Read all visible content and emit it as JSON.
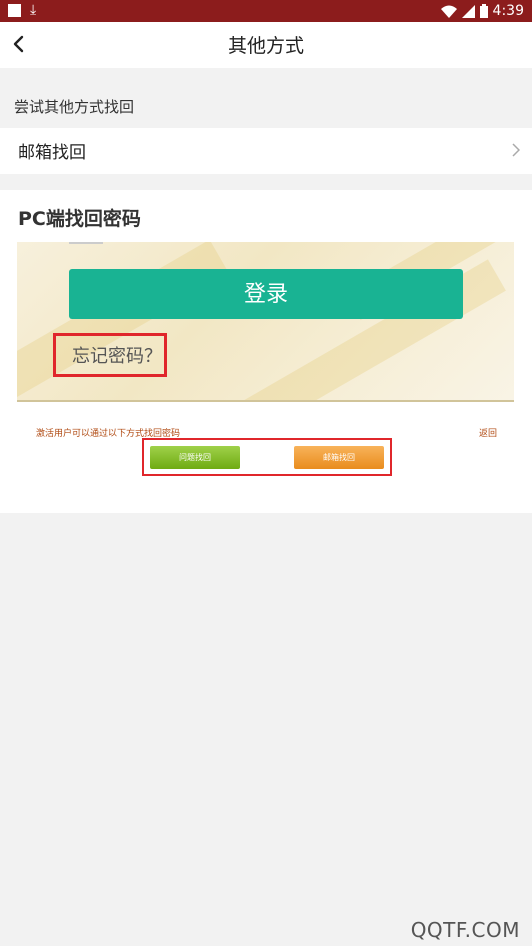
{
  "status_bar": {
    "time": "4:39"
  },
  "header": {
    "title": "其他方式"
  },
  "section": {
    "label": "尝试其他方式找回"
  },
  "email_option": {
    "label": "邮箱找回"
  },
  "pc_section": {
    "heading": "PC端找回密码",
    "screenshot": {
      "login_label": "登录",
      "forgot_label": "忘记密码？",
      "hint": "激活用户可以通过以下方式找回密码",
      "back_label": "返回",
      "question_button": "问题找回",
      "email_button": "邮箱找回"
    }
  },
  "watermark": "QQTF.COM",
  "colors": {
    "status_bar": "#8c1c1c",
    "login_button": "#19b393",
    "highlight": "#e0262b",
    "green_button": "#7cb518",
    "orange_button": "#ef9a2e"
  }
}
